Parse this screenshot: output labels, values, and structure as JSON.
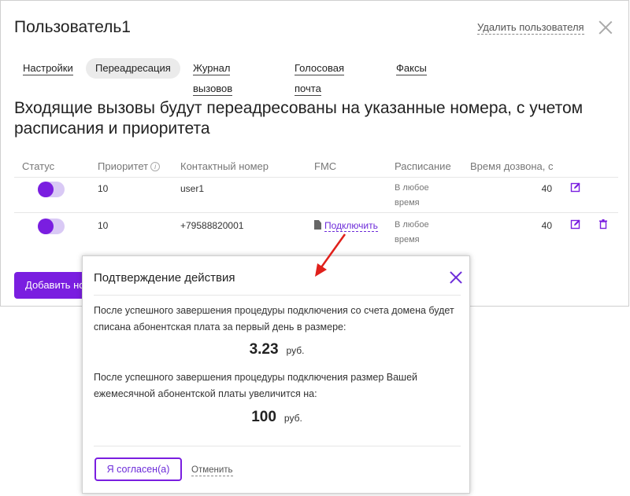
{
  "header": {
    "title": "Пользователь1",
    "delete_user": "Удалить пользователя"
  },
  "tabs": [
    {
      "label": "Настройки",
      "active": false
    },
    {
      "label": "Переадресация",
      "active": true
    },
    {
      "label": "Журнал вызовов",
      "active": false
    },
    {
      "label": "Голосовая почта",
      "active": false
    },
    {
      "label": "Факсы",
      "active": false
    }
  ],
  "heading": "Входящие вызовы будут переадресованы на указанные номера, с учетом расписания и приоритета",
  "table": {
    "columns": {
      "status": "Статус",
      "priority": "Приоритет",
      "contact": "Контактный номер",
      "fmc": "FMC",
      "schedule": "Расписание",
      "ring_time": "Время дозвона, с"
    },
    "rows": [
      {
        "status_on": true,
        "priority": "10",
        "contact": "user1",
        "fmc": "",
        "schedule_line1": "В любое",
        "schedule_line2": "время",
        "ring_time": "40"
      },
      {
        "status_on": true,
        "priority": "10",
        "contact": "+79588820001",
        "fmc": "Подключить",
        "schedule_line1": "В любое",
        "schedule_line2": "время",
        "ring_time": "40"
      }
    ]
  },
  "add_button": "Добавить но",
  "modal": {
    "title": "Подтверждение действия",
    "text1": "После успешного завершения процедуры подключения со счета домена будет списана абонентская плата за первый день в размере:",
    "amount1": "3.23",
    "currency1": "руб.",
    "text2": "После успешного завершения процедуры подключения размер Вашей ежемесячной абонентской платы увеличится на:",
    "amount2": "100",
    "currency2": "руб.",
    "agree": "Я согласен(а)",
    "cancel": "Отменить"
  },
  "colors": {
    "accent": "#7a1ee0",
    "toggle_track": "#d9c9f5",
    "annotation_arrow": "#e0201b"
  }
}
